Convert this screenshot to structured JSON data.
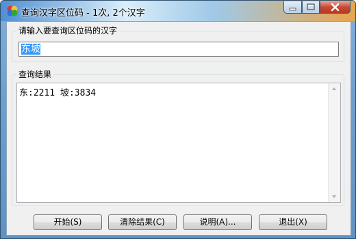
{
  "window": {
    "title": "查询汉字区位码 - 1次, 2个汉字"
  },
  "input_group": {
    "label": "请输入要查询区位码的汉字",
    "value": "东坡"
  },
  "result_group": {
    "label": "查询结果",
    "text": "东:2211 坡:3834"
  },
  "buttons": {
    "start": "开始(S)",
    "clear": "清除结果(C)",
    "help": "说明(A)...",
    "exit": "退出(X)"
  }
}
